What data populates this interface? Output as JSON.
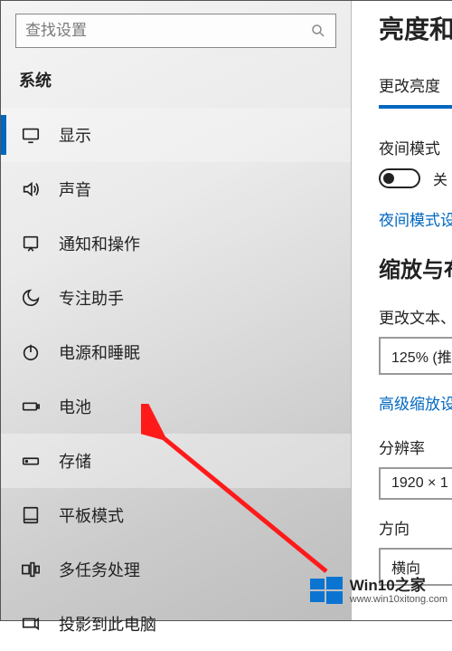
{
  "search": {
    "placeholder": "查找设置"
  },
  "sidebar": {
    "section": "系统",
    "items": [
      {
        "label": "显示"
      },
      {
        "label": "声音"
      },
      {
        "label": "通知和操作"
      },
      {
        "label": "专注助手"
      },
      {
        "label": "电源和睡眠"
      },
      {
        "label": "电池"
      },
      {
        "label": "存储"
      },
      {
        "label": "平板模式"
      },
      {
        "label": "多任务处理"
      },
      {
        "label": "投影到此电脑"
      }
    ]
  },
  "content": {
    "title": "亮度和颜",
    "brightness_label": "更改亮度",
    "night_mode_label": "夜间模式",
    "night_mode_off": "关",
    "night_mode_link": "夜间模式设",
    "scale_heading": "缩放与布",
    "text_label": "更改文本、",
    "scale_value": "125% (推",
    "advanced_link": "高级缩放设",
    "resolution_label": "分辨率",
    "resolution_value": "1920 × 1",
    "orientation_label": "方向",
    "orientation_value": "横向"
  },
  "watermark": {
    "title": "Win10之家",
    "url": "www.win10xitong.com"
  }
}
